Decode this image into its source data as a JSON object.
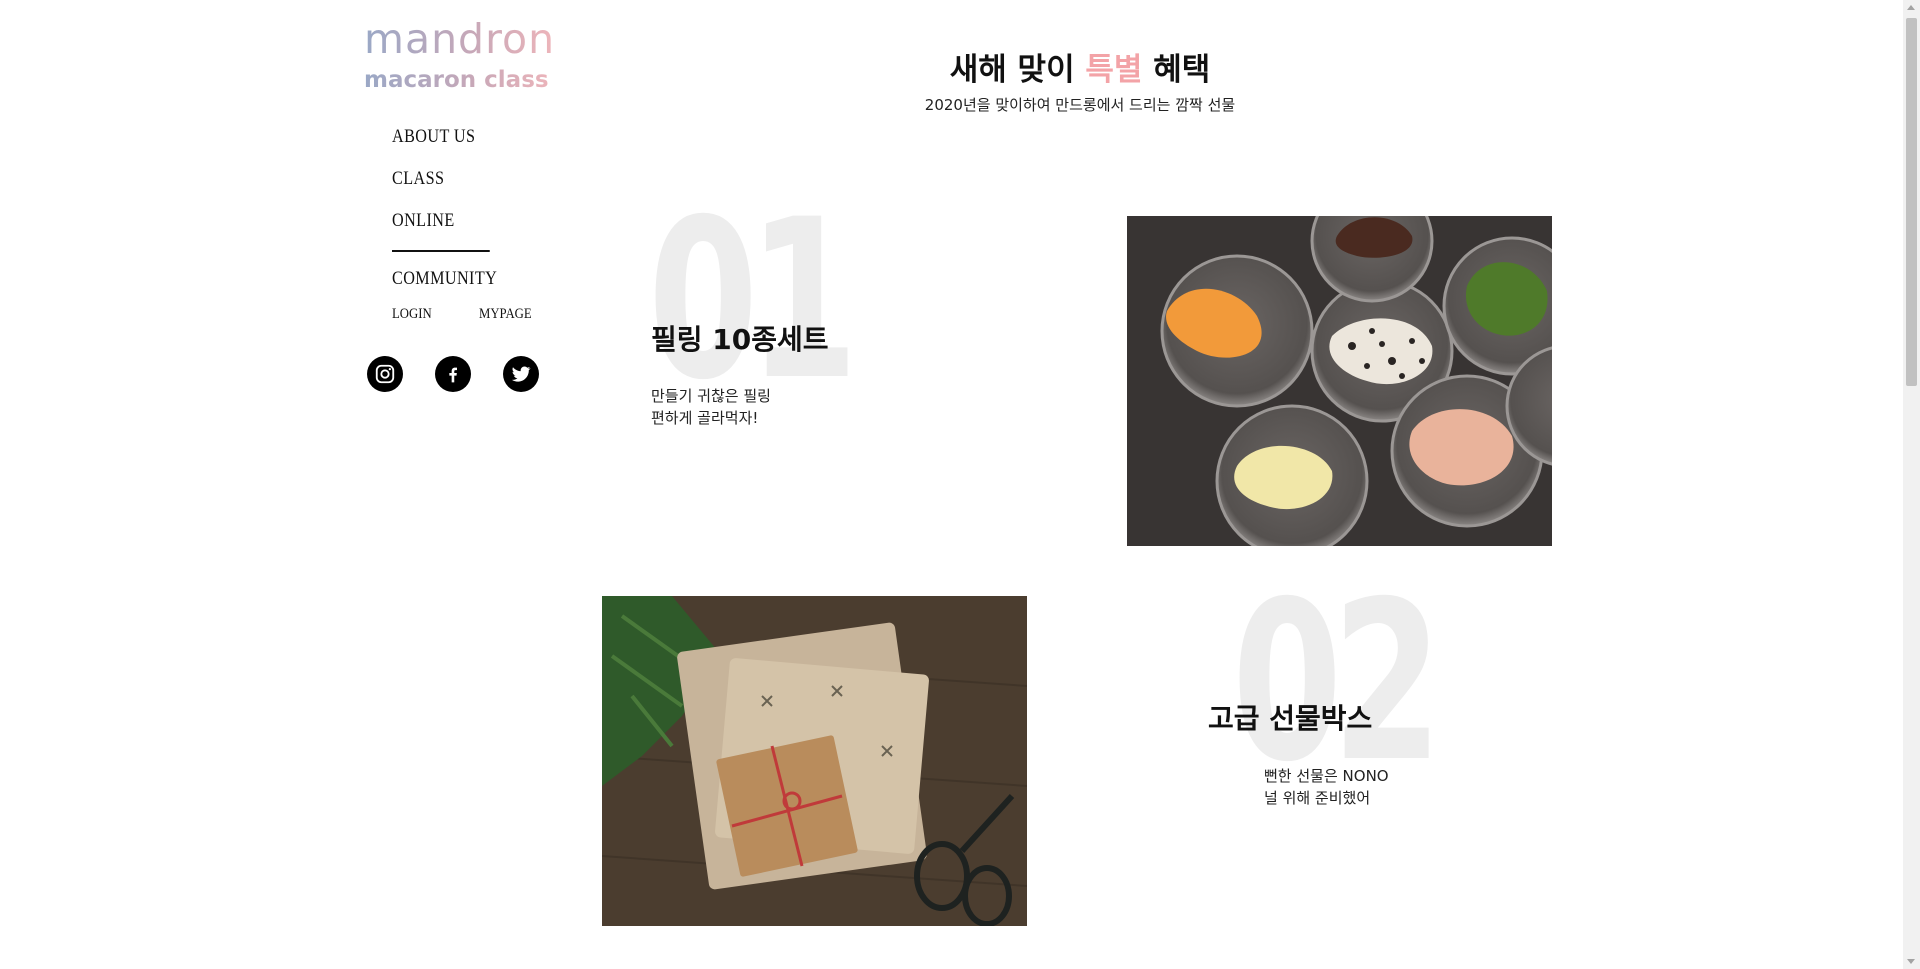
{
  "brand": {
    "name": "mandron",
    "tagline": "macaron class"
  },
  "nav": {
    "items": [
      {
        "label": "ABOUT US"
      },
      {
        "label": "CLASS"
      },
      {
        "label": "ONLINE"
      },
      {
        "label": "COMMUNITY"
      }
    ],
    "active": "ONLINE",
    "login": "LOGIN",
    "mypage": "MYPAGE"
  },
  "social": [
    "instagram-icon",
    "facebook-icon",
    "twitter-icon"
  ],
  "header": {
    "title_pre": "새해 맞이 ",
    "title_accent": "특별",
    "title_post": " 혜택",
    "subtitle": "2020년을 맞이하여 만드롱에서 드리는 깜짝 선물",
    "accent_color": "#f3a3a7"
  },
  "items": [
    {
      "number": "01",
      "title": "필링 10종세트",
      "desc_line1": "만들기 귀찮은 필링",
      "desc_line2": "편하게 골라먹자!"
    },
    {
      "number": "02",
      "title": "고급 선물박스",
      "desc_line1": "뻔한 선물은 NONO",
      "desc_line2": "널 위해 준비했어"
    }
  ]
}
